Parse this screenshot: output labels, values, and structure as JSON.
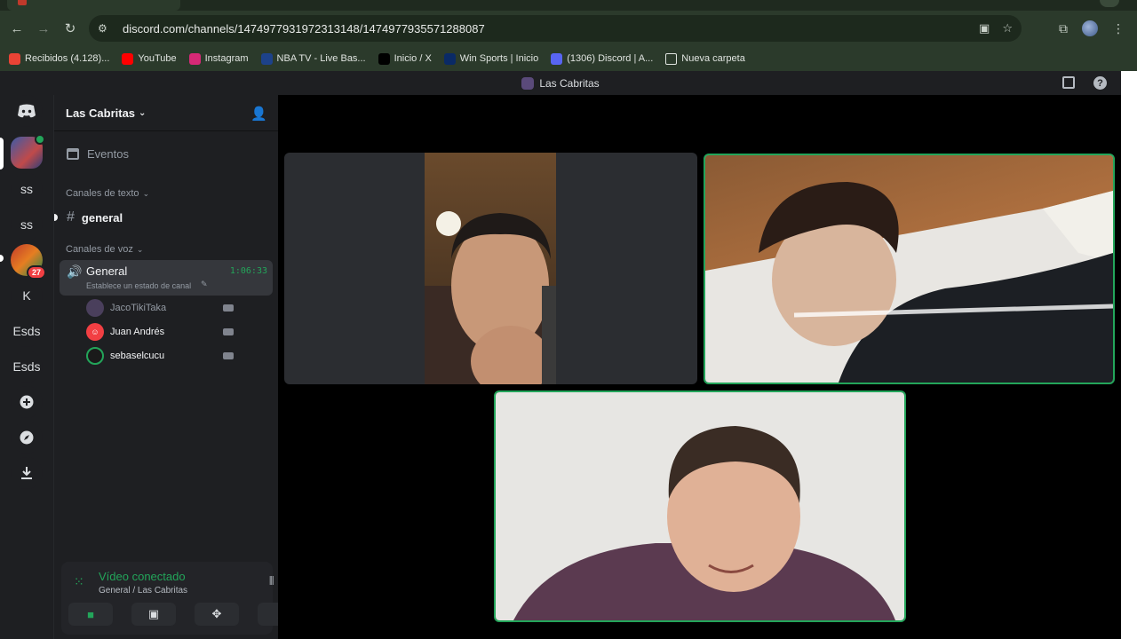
{
  "browser": {
    "url": "discord.com/channels/1474977931972313148/1474977935571288087",
    "bookmarks": [
      {
        "label": "Recibidos (4.128)...",
        "icon": "gmail-icon",
        "color": "#ea4335",
        "glyph": "M"
      },
      {
        "label": "YouTube",
        "icon": "youtube-icon",
        "color": "#ff0000",
        "glyph": "▶"
      },
      {
        "label": "Instagram",
        "icon": "instagram-icon",
        "color": "#d62976",
        "glyph": "◎"
      },
      {
        "label": "NBA TV - Live Bas...",
        "icon": "nba-icon",
        "color": "#1d428a",
        "glyph": "N"
      },
      {
        "label": "Inicio / X",
        "icon": "x-icon",
        "color": "#000000",
        "glyph": "X"
      },
      {
        "label": "Win Sports | Inicio",
        "icon": "winsports-icon",
        "color": "#0a2a66",
        "glyph": "w"
      },
      {
        "label": "(1306) Discord | A...",
        "icon": "discord-bookmark-icon",
        "color": "#5865f2",
        "glyph": "27"
      },
      {
        "label": "Nueva carpeta",
        "icon": "folder-icon",
        "color": "#2b3a2b",
        "glyph": "▭"
      }
    ]
  },
  "titlebar": {
    "title": "Las Cabritas"
  },
  "rail": {
    "items": [
      {
        "label": "ss"
      },
      {
        "label": "ss"
      },
      {
        "label": "K"
      },
      {
        "label": "Esds"
      },
      {
        "label": "Esds"
      }
    ],
    "badge": "27"
  },
  "sidebar": {
    "server_name": "Las Cabritas",
    "events_label": "Eventos",
    "text_category": "Canales de texto",
    "text_channel": "general",
    "voice_category": "Canales de voz",
    "voice_channel": "General",
    "voice_timer": "1:06:33",
    "voice_status": "Establece un estado de canal",
    "members": [
      {
        "name": "JacoTikiTaka",
        "color": "#949ba4",
        "avatar_bg": "#4a3f5c"
      },
      {
        "name": "Juan Andrés",
        "color": "#f2f3f5",
        "avatar_bg": "#f23f43"
      },
      {
        "name": "sebaselcucu",
        "color": "#f2f3f5",
        "avatar_bg": "#1a1a1a"
      }
    ]
  },
  "voice_panel": {
    "status": "Vídeo conectado",
    "location": "General / Las Cabritas",
    "status_color": "#23a55a"
  },
  "colors": {
    "speaking_border": "#23a55a",
    "discord_blurple": "#5865f2"
  }
}
